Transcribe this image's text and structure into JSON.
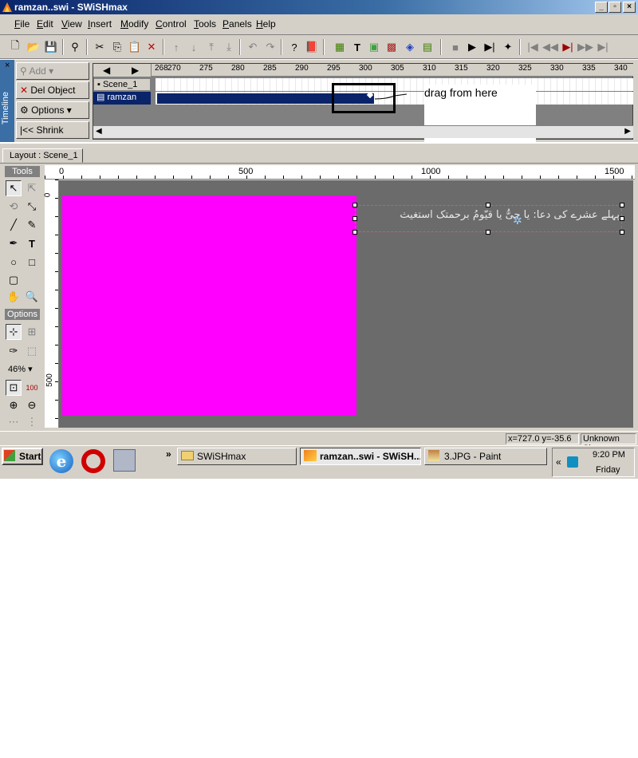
{
  "window": {
    "title": "ramzan..swi - SWiSHmax"
  },
  "menubar": [
    "File",
    "Edit",
    "View",
    "Insert",
    "Modify",
    "Control",
    "Tools",
    "Panels",
    "Help"
  ],
  "timeline": {
    "side_label": "Timeline",
    "buttons": {
      "add": "Add",
      "del": "Del Object",
      "options": "Options",
      "shrink": "Shrink"
    },
    "ruler_ticks": [
      "268",
      "270",
      "275",
      "280",
      "285",
      "290",
      "295",
      "300",
      "305",
      "310",
      "315",
      "320",
      "325",
      "330",
      "335",
      "340"
    ],
    "rows": [
      {
        "label": "Scene_1"
      },
      {
        "label": "ramzan"
      }
    ],
    "annotation": "drag from here"
  },
  "layout": {
    "tab_label": "Layout : Scene_1",
    "tools_header": "Tools",
    "options_header": "Options",
    "zoom": "46%",
    "hruler_ticks": [
      "0",
      "500",
      "1000",
      "1500"
    ],
    "vruler_ticks": [
      "0",
      "500"
    ],
    "text_object": "پہلے عشرے کی دعا: یا حیُّ یا قیّومُ برحمتک استغیث",
    "stage_color": "#ff00ff"
  },
  "status": {
    "coords": "x=727.0 y=-35.6",
    "size": "Unknown Size"
  },
  "taskbar": {
    "start": "Start",
    "tasks": [
      {
        "label": "SWiSHmax"
      },
      {
        "label": "ramzan..swi - SWiSH..."
      },
      {
        "label": "3.JPG - Paint"
      }
    ],
    "clock": "9:20 PM",
    "day": "Friday"
  }
}
